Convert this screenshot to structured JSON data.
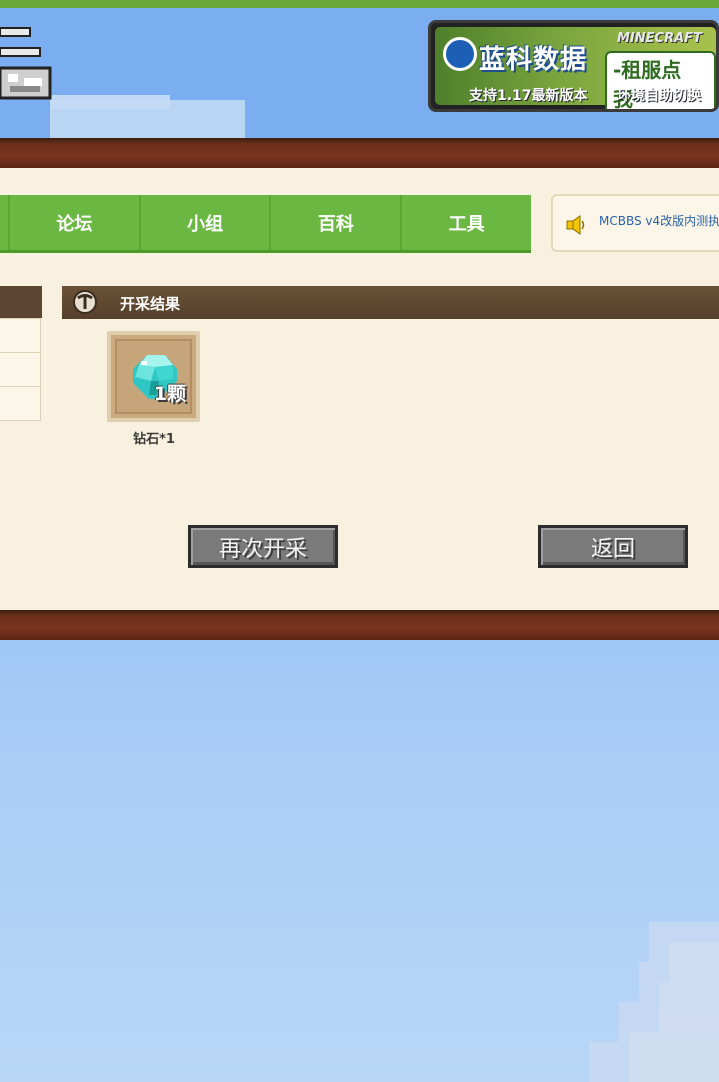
{
  "header": {
    "ad": {
      "brand": "蓝科数据",
      "mc_logo": "MINECRAFT",
      "rent_label": "-租服点我-",
      "subtitle_left": "支持1.17最新版本",
      "subtitle_right": "环境自助切换"
    }
  },
  "nav": {
    "items": [
      {
        "label": "论坛"
      },
      {
        "label": "小组"
      },
      {
        "label": "百科"
      },
      {
        "label": "工具"
      }
    ]
  },
  "notice": {
    "icon": "speaker-icon",
    "text": "MCBBS v4改版内测执"
  },
  "result": {
    "title": "开采结果",
    "icon": "pickaxe-icon",
    "item": {
      "icon": "diamond-icon",
      "count_label": "1颗",
      "name": "钻石*1"
    }
  },
  "buttons": {
    "again": "再次开采",
    "back": "返回"
  },
  "colors": {
    "nav_green": "#6ab842",
    "wood": "#7c3520",
    "panel": "#f8f1df",
    "notice_text": "#2a62a8"
  }
}
